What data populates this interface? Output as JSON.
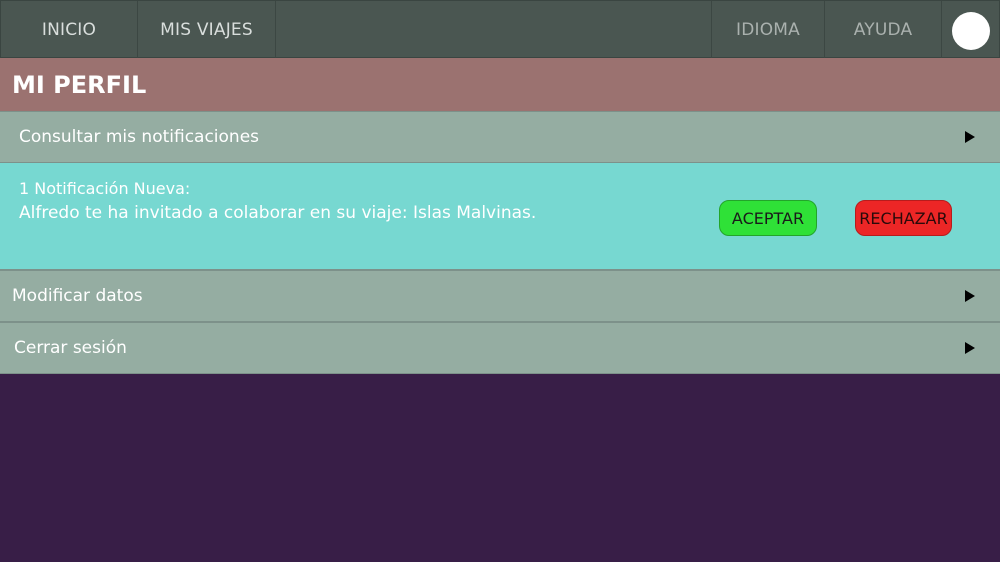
{
  "nav": {
    "left": [
      "INICIO",
      "MIS VIAJES"
    ],
    "right": [
      "IDIOMA",
      "AYUDA"
    ]
  },
  "profile": {
    "title": "MI PERFIL"
  },
  "sections": {
    "notifications": "Consultar mis notificaciones",
    "modify": "Modificar datos",
    "logout": "Cerrar sesión"
  },
  "notification": {
    "title": "1 Notificación Nueva:",
    "message": "Alfredo te ha invitado a colaborar en su viaje: Islas Malvinas.",
    "accept_label": "ACEPTAR",
    "reject_label": "RECHAZAR"
  },
  "colors": {
    "topbar": "#4a5651",
    "header": "#9b7270",
    "row": "#95ada2",
    "notification": "#77d8d1",
    "accept": "#2fe137",
    "reject": "#ec2626",
    "background": "#381e47"
  }
}
